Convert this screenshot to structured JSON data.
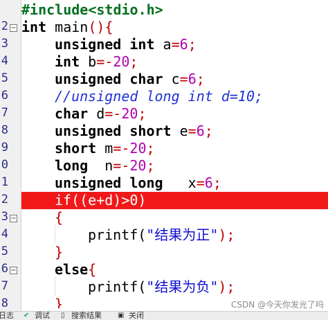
{
  "editor": {
    "line_numbers": [
      "",
      "2",
      "3",
      "4",
      "5",
      "6",
      "7",
      "8",
      "9",
      "0",
      "1",
      "2",
      "3",
      "4",
      "5",
      "6",
      "7",
      "8"
    ],
    "lines": [
      {
        "pp": "#include<stdio.h>"
      },
      {
        "kw": "int",
        "rest": " main",
        "paren": "(){"
      },
      {
        "kw": "unsigned int",
        "v": " a",
        "op": "=",
        "num": "6",
        "end": ";"
      },
      {
        "kw": "int",
        "v": " b",
        "op": "=-",
        "num": "20",
        "end": ";"
      },
      {
        "kw": "unsigned char",
        "v": " c",
        "op": "=",
        "num": "6",
        "end": ";"
      },
      {
        "comment": "//unsigned long int d=10;"
      },
      {
        "kw": "char",
        "v": " d",
        "op": "=-",
        "num": "20",
        "end": ";"
      },
      {
        "kw": "unsigned short",
        "v": " e",
        "op": "=",
        "num": "6",
        "end": ";"
      },
      {
        "kw": "short",
        "v": " m",
        "op": "=-",
        "num": "20",
        "end": ";"
      },
      {
        "kw": "long",
        "v": "  n",
        "op": "=-",
        "num": "20",
        "end": ";"
      },
      {
        "kw": "unsigned long",
        "v": "   x",
        "op": "=",
        "num": "6",
        "end": ";"
      },
      {
        "text": "if((e+d)>0)"
      },
      {
        "brace": "{"
      },
      {
        "fn": "printf(",
        "str": "\"结果为正\"",
        "end": ");"
      },
      {
        "brace": "}"
      },
      {
        "kw": "else",
        "brace": "{"
      },
      {
        "fn": "printf(",
        "str": "\"结果为负\"",
        "end": ");"
      },
      {
        "brace": "}"
      }
    ]
  },
  "statusbar": {
    "items": [
      "日志",
      "调试",
      "搜索结果",
      "关闭"
    ]
  },
  "watermark": "CSDN @今天你发光了吗",
  "colors": {
    "highlight": "#f01818",
    "keyword": "#000000",
    "number": "#b000b0",
    "string": "#1010d0",
    "comment": "#2030d8"
  }
}
